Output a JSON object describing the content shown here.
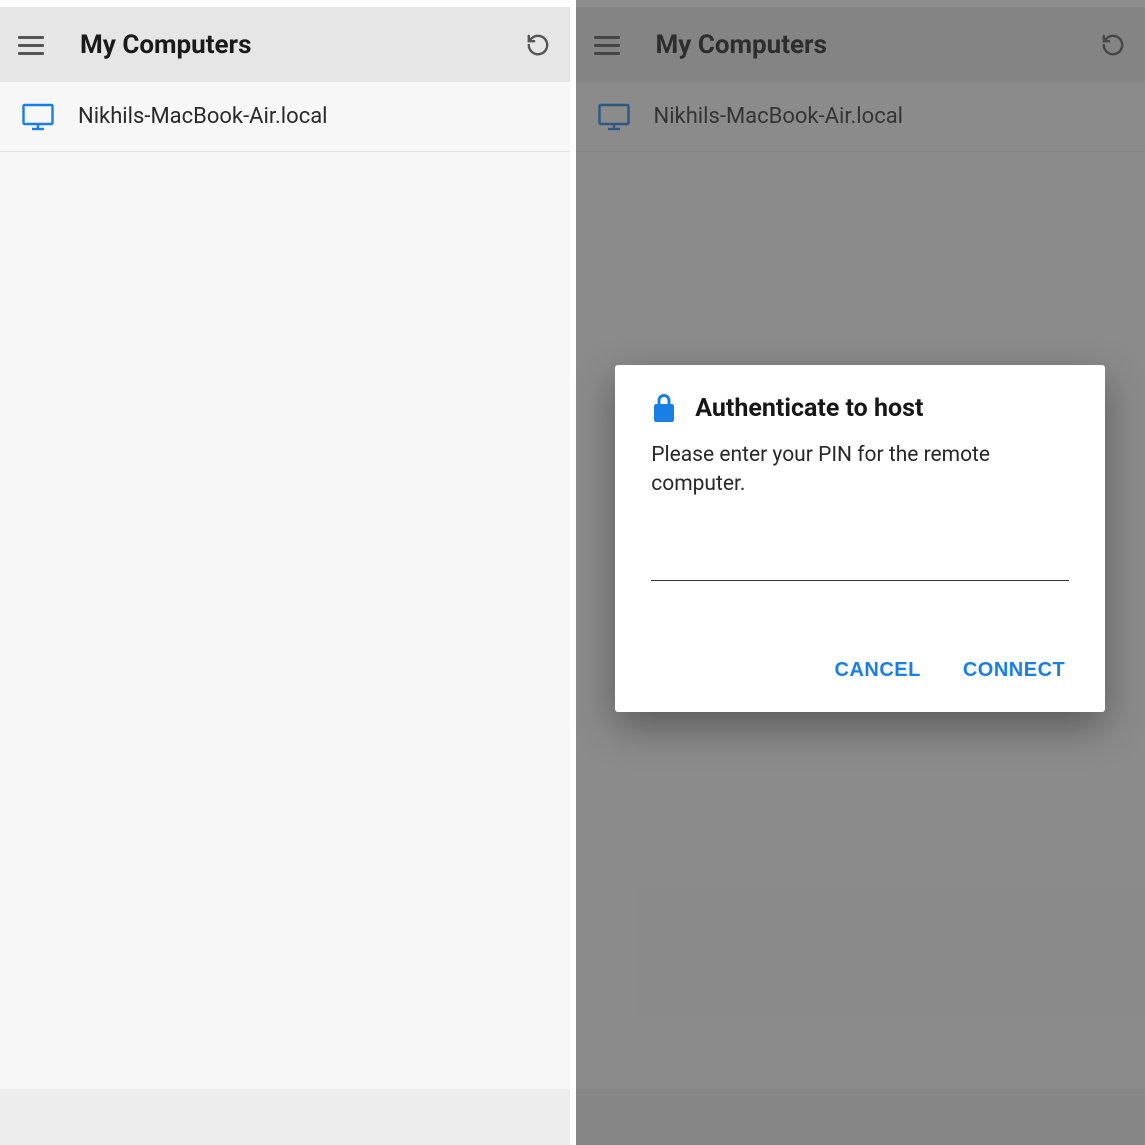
{
  "left": {
    "appbar": {
      "title": "My Computers"
    },
    "computer": {
      "name": "Nikhils-MacBook-Air.local"
    }
  },
  "right": {
    "appbar": {
      "title": "My Computers"
    },
    "computer": {
      "name": "Nikhils-MacBook-Air.local"
    },
    "dialog": {
      "title": "Authenticate to host",
      "message": "Please enter your PIN for the remote computer.",
      "pin_value": "",
      "cancel": "CANCEL",
      "connect": "CONNECT"
    }
  },
  "colors": {
    "accent": "#197fe5"
  }
}
